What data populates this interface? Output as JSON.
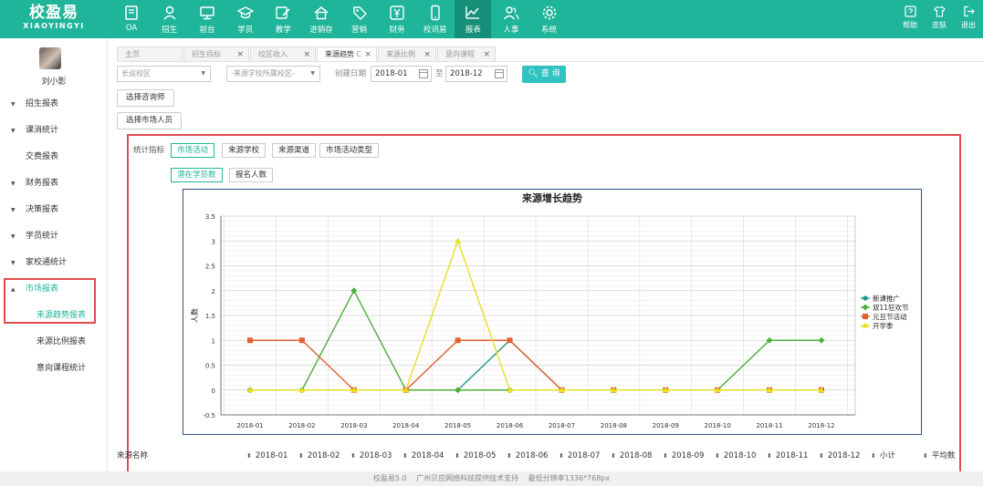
{
  "header": {
    "logo_cn": "校盈易",
    "logo_en": "XIAOYINGYI",
    "nav": [
      {
        "label": "OA",
        "icon": "oa-book-icon"
      },
      {
        "label": "招生",
        "icon": "recruit-person-icon"
      },
      {
        "label": "前台",
        "icon": "front-desk-monitor-icon"
      },
      {
        "label": "学员",
        "icon": "student-cap-icon"
      },
      {
        "label": "教学",
        "icon": "teaching-edit-icon"
      },
      {
        "label": "进销存",
        "icon": "inventory-house-icon"
      },
      {
        "label": "营销",
        "icon": "marketing-tag-icon"
      },
      {
        "label": "财务",
        "icon": "finance-yen-icon"
      },
      {
        "label": "校讯易",
        "icon": "phone-icon"
      },
      {
        "label": "报表",
        "icon": "report-chart-icon"
      },
      {
        "label": "人事",
        "icon": "hr-people-icon"
      },
      {
        "label": "系统",
        "icon": "system-gear-icon"
      }
    ],
    "active_nav": "报表",
    "right": [
      {
        "label": "帮助",
        "icon": "help-icon"
      },
      {
        "label": "皮肤",
        "icon": "skin-shirt-icon"
      },
      {
        "label": "退出",
        "icon": "logout-icon"
      }
    ]
  },
  "sidebar": {
    "username": "刘小影",
    "items": [
      {
        "label": "招生报表",
        "caret": "▼"
      },
      {
        "label": "课消统计",
        "caret": "▼"
      },
      {
        "label": "交费报表",
        "caret": ""
      },
      {
        "label": "财务报表",
        "caret": "▼"
      },
      {
        "label": "决策报表",
        "caret": "▼"
      },
      {
        "label": "学员统计",
        "caret": "▼"
      },
      {
        "label": "家校通统计",
        "caret": "▼"
      },
      {
        "label": "市场报表",
        "caret": "▲"
      }
    ],
    "sub_items": [
      {
        "label": "来源趋势报表"
      },
      {
        "label": "来源比例报表"
      },
      {
        "label": "意向课程统计"
      }
    ]
  },
  "tabs": [
    {
      "label": "主页",
      "closable": false,
      "width": 72
    },
    {
      "label": "招生目标",
      "closable": true,
      "width": 72
    },
    {
      "label": "校区收入",
      "closable": true,
      "width": 72
    },
    {
      "label": "来源趋势",
      "closable": true,
      "width": 66,
      "refresh": "C",
      "active": true
    },
    {
      "label": "来源比例",
      "closable": true,
      "width": 64
    },
    {
      "label": "意向课程",
      "closable": true,
      "width": 64
    }
  ],
  "filters": {
    "campus": "长运校区",
    "school": "-来源学校所属校区-",
    "date_label": "创建日期",
    "date_from": "2018-01",
    "date_to_sep": "至",
    "date_to": "2018-12",
    "search_label": "查 询",
    "consultant_btn": "选择咨询师",
    "market_btn": "选择市场人员"
  },
  "metrics": {
    "label": "统计指标",
    "options": [
      "市场活动",
      "来源学校",
      "来源渠道",
      "市场活动类型"
    ],
    "selected": "市场活动",
    "subs": [
      "潜在学员数",
      "报名人数"
    ],
    "sub_selected": "潜在学员数"
  },
  "chart_data": {
    "type": "line",
    "title": "来源增长趋势",
    "ylabel": "人数",
    "xlabel": "",
    "categories": [
      "2018-01",
      "2018-02",
      "2018-03",
      "2018-04",
      "2018-05",
      "2018-06",
      "2018-07",
      "2018-08",
      "2018-09",
      "2018-10",
      "2018-11",
      "2018-12"
    ],
    "ylim": [
      -0.5,
      3.5
    ],
    "yticks": [
      -0.5,
      0,
      0.5,
      1,
      1.5,
      2,
      2.5,
      3,
      3.5
    ],
    "grid": true,
    "legend": "right",
    "series": [
      {
        "name": "新课推广",
        "color": "#1f9a8a",
        "marker": "circle",
        "values": [
          0,
          0,
          0,
          0,
          0,
          1,
          0,
          0,
          0,
          0,
          0,
          0
        ]
      },
      {
        "name": "双11狂欢节",
        "color": "#4caf3a",
        "marker": "diamond",
        "values": [
          0,
          0,
          2,
          0,
          0,
          0,
          0,
          0,
          0,
          0,
          1,
          1
        ]
      },
      {
        "name": "元旦节活动",
        "color": "#e06030",
        "marker": "square",
        "values": [
          1,
          1,
          0,
          0,
          1,
          1,
          0,
          0,
          0,
          0,
          0,
          0
        ]
      },
      {
        "name": "开学季",
        "color": "#e8e020",
        "marker": "triangle",
        "values": [
          0,
          0,
          0,
          0,
          3,
          0,
          0,
          0,
          0,
          0,
          0,
          0
        ]
      }
    ]
  },
  "table": {
    "columns": [
      "来源名称",
      "2018-01",
      "2018-02",
      "2018-03",
      "2018-04",
      "2018-05",
      "2018-06",
      "2018-07",
      "2018-08",
      "2018-09",
      "2018-10",
      "2018-11",
      "2018-12",
      "小计",
      "平均数"
    ]
  },
  "footer": "校盈易5.0　 广州贝应网络科技提供技术支持　 最低分辨率1336*768px"
}
